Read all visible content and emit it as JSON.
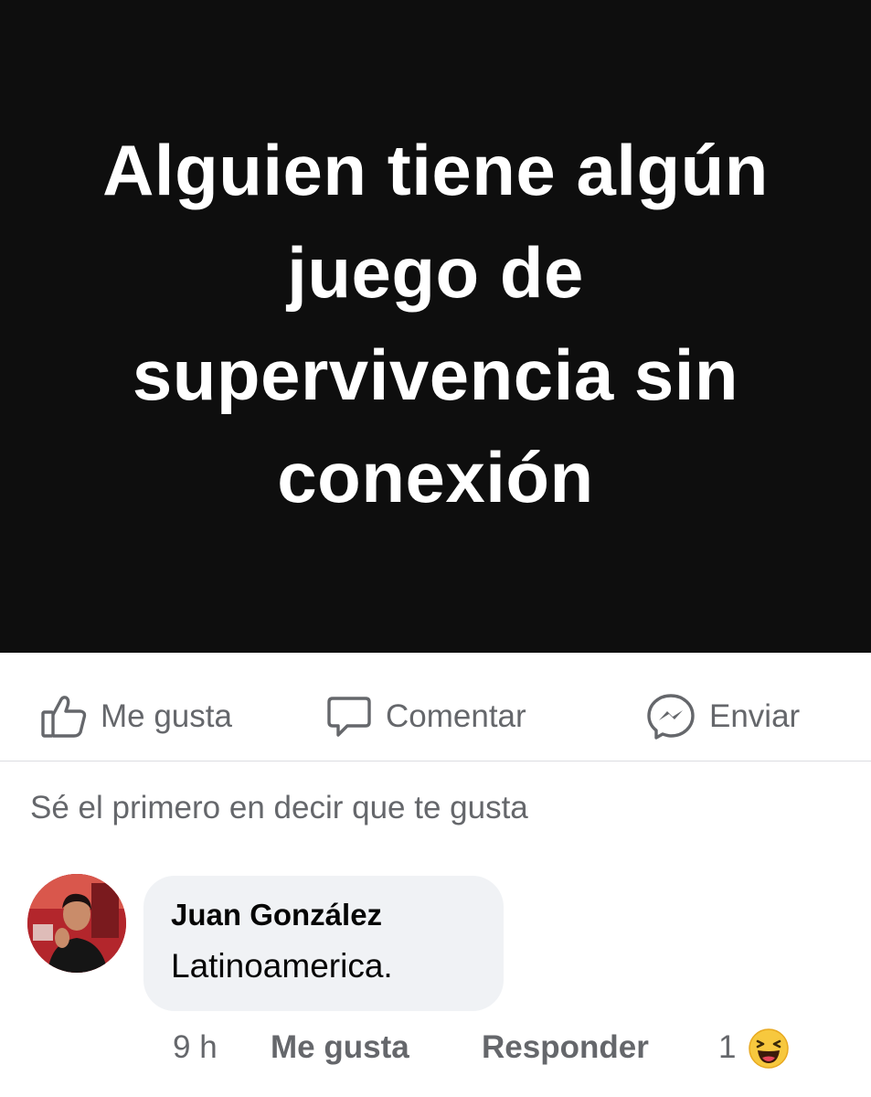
{
  "post": {
    "text_lines": [
      "Alguien tiene algún",
      "juego de",
      "supervivencia sin",
      "conexión"
    ]
  },
  "actions": {
    "like_label": "Me gusta",
    "comment_label": "Comentar",
    "send_label": "Enviar"
  },
  "reactions_summary": "Sé el primero en decir que te gusta",
  "comment": {
    "author": "Juan González",
    "text": "Latinoamerica.",
    "time": "9 h",
    "like_label": "Me gusta",
    "reply_label": "Responder",
    "reaction_count": "1"
  },
  "icons": {
    "like": "thumbs-up-icon",
    "comment": "speech-bubble-icon",
    "send": "messenger-icon",
    "reaction": "laughing-emoji-icon"
  },
  "colors": {
    "post_background": "#0e0e0e",
    "post_text": "#ffffff",
    "secondary_text": "#65676b",
    "primary_text": "#050505",
    "bubble_background": "#f0f2f5"
  }
}
